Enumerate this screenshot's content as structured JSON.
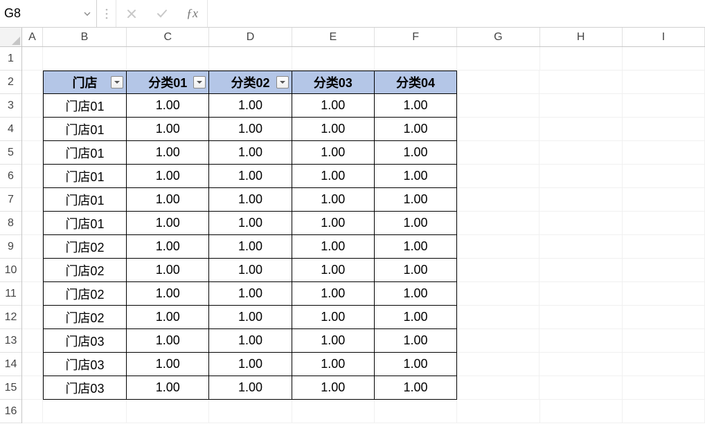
{
  "namebox": {
    "value": "G8"
  },
  "columns": [
    "A",
    "B",
    "C",
    "D",
    "E",
    "F",
    "G",
    "H",
    "I"
  ],
  "rows": [
    "1",
    "2",
    "3",
    "4",
    "5",
    "6",
    "7",
    "8",
    "9",
    "10",
    "11",
    "12",
    "13",
    "14",
    "15",
    "16"
  ],
  "table": {
    "headers": [
      "门店",
      "分类01",
      "分类02",
      "分类03",
      "分类04"
    ],
    "filter_on": [
      true,
      true,
      true,
      false,
      false
    ],
    "rows": [
      [
        "门店01",
        "1.00",
        "1.00",
        "1.00",
        "1.00"
      ],
      [
        "门店01",
        "1.00",
        "1.00",
        "1.00",
        "1.00"
      ],
      [
        "门店01",
        "1.00",
        "1.00",
        "1.00",
        "1.00"
      ],
      [
        "门店01",
        "1.00",
        "1.00",
        "1.00",
        "1.00"
      ],
      [
        "门店01",
        "1.00",
        "1.00",
        "1.00",
        "1.00"
      ],
      [
        "门店01",
        "1.00",
        "1.00",
        "1.00",
        "1.00"
      ],
      [
        "门店02",
        "1.00",
        "1.00",
        "1.00",
        "1.00"
      ],
      [
        "门店02",
        "1.00",
        "1.00",
        "1.00",
        "1.00"
      ],
      [
        "门店02",
        "1.00",
        "1.00",
        "1.00",
        "1.00"
      ],
      [
        "门店02",
        "1.00",
        "1.00",
        "1.00",
        "1.00"
      ],
      [
        "门店03",
        "1.00",
        "1.00",
        "1.00",
        "1.00"
      ],
      [
        "门店03",
        "1.00",
        "1.00",
        "1.00",
        "1.00"
      ],
      [
        "门店03",
        "1.00",
        "1.00",
        "1.00",
        "1.00"
      ]
    ]
  },
  "chart_data": {
    "type": "table",
    "title": "",
    "columns": [
      "门店",
      "分类01",
      "分类02",
      "分类03",
      "分类04"
    ],
    "rows": [
      [
        "门店01",
        1.0,
        1.0,
        1.0,
        1.0
      ],
      [
        "门店01",
        1.0,
        1.0,
        1.0,
        1.0
      ],
      [
        "门店01",
        1.0,
        1.0,
        1.0,
        1.0
      ],
      [
        "门店01",
        1.0,
        1.0,
        1.0,
        1.0
      ],
      [
        "门店01",
        1.0,
        1.0,
        1.0,
        1.0
      ],
      [
        "门店01",
        1.0,
        1.0,
        1.0,
        1.0
      ],
      [
        "门店02",
        1.0,
        1.0,
        1.0,
        1.0
      ],
      [
        "门店02",
        1.0,
        1.0,
        1.0,
        1.0
      ],
      [
        "门店02",
        1.0,
        1.0,
        1.0,
        1.0
      ],
      [
        "门店02",
        1.0,
        1.0,
        1.0,
        1.0
      ],
      [
        "门店03",
        1.0,
        1.0,
        1.0,
        1.0
      ],
      [
        "门店03",
        1.0,
        1.0,
        1.0,
        1.0
      ],
      [
        "门店03",
        1.0,
        1.0,
        1.0,
        1.0
      ]
    ]
  }
}
